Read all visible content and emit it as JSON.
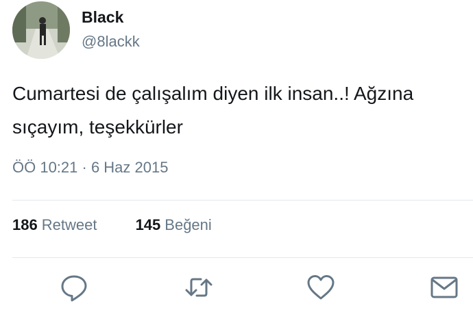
{
  "user": {
    "name": "Black",
    "handle": "@8lackk",
    "avatar_icon": "profile-photo"
  },
  "tweet": {
    "text": "Cumartesi de çalışalım diyen ilk insan..! Ağzına sıçayım, teşekkürler",
    "timestamp": "ÖÖ 10:21 · 6 Haz 2015"
  },
  "stats": {
    "retweets_count": "186",
    "retweets_label": "Retweet",
    "likes_count": "145",
    "likes_label": "Beğeni"
  },
  "actions": {
    "reply_icon": "reply-icon",
    "retweet_icon": "retweet-icon",
    "like_icon": "heart-icon",
    "message_icon": "envelope-icon",
    "icon_color": "#657786"
  }
}
